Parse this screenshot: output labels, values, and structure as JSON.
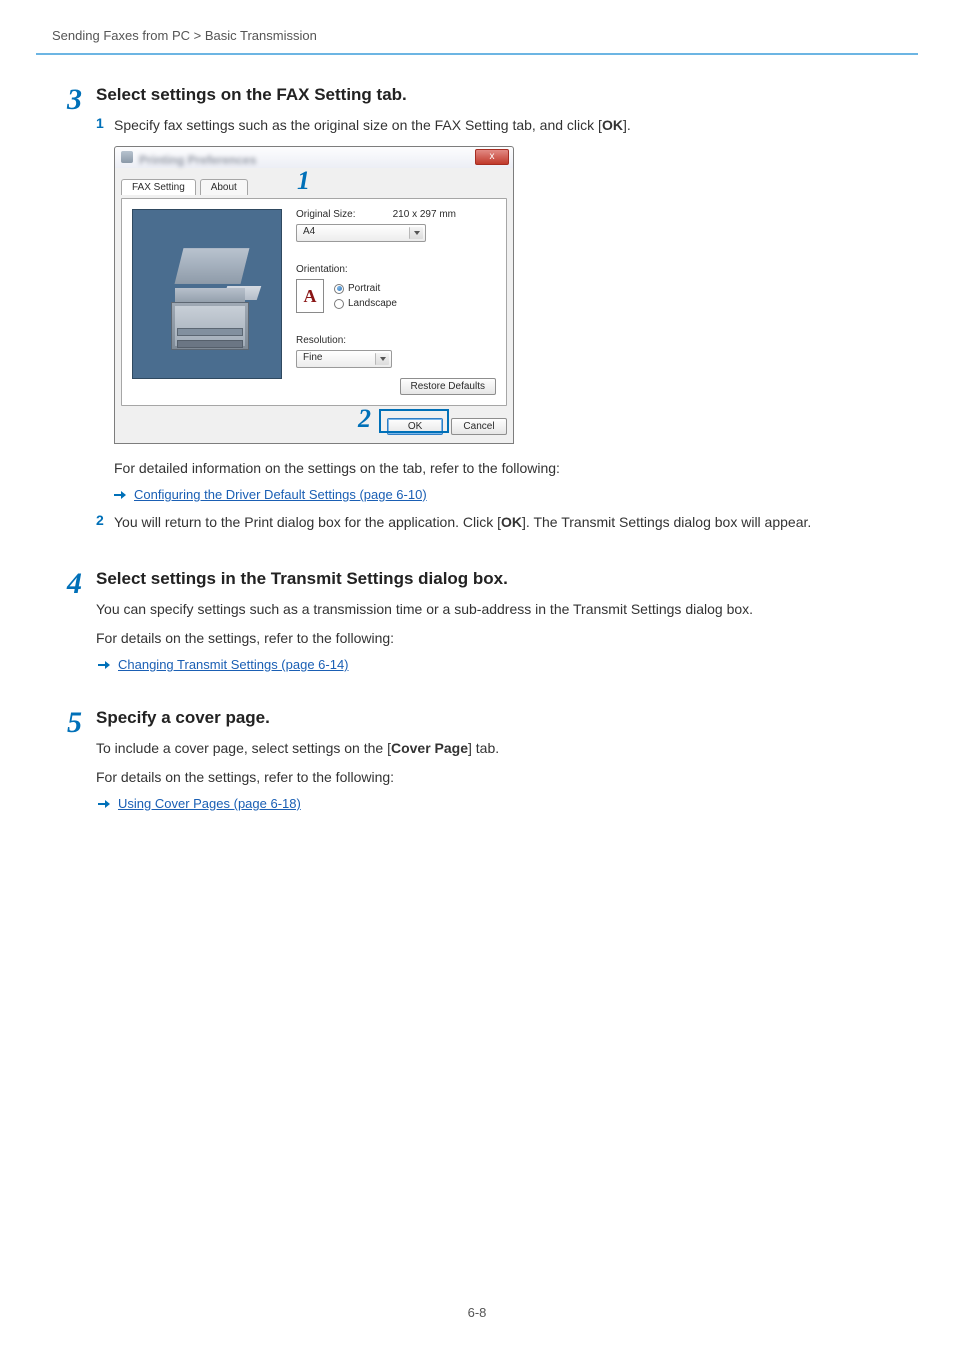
{
  "breadcrumb": "Sending Faxes from PC > Basic Transmission",
  "step3": {
    "num": "3",
    "title": "Select settings on the FAX Setting tab.",
    "sub1_num": "1",
    "sub1_text_pre": "Specify fax settings such as the original size on the FAX Setting tab, and click [",
    "sub1_text_bold": "OK",
    "sub1_text_post": "].",
    "after_img": "For detailed information on the settings on the tab, refer to the following:",
    "link": "Configuring the Driver Default Settings (page 6-10)",
    "sub2_num": "2",
    "sub2_text_pre": "You will return to the Print dialog box for the application. Click [",
    "sub2_text_bold": "OK",
    "sub2_text_post": "]. The Transmit Settings dialog box will appear."
  },
  "step4": {
    "num": "4",
    "title": "Select settings in the Transmit Settings dialog box.",
    "p1": "You can specify settings such as a transmission time or a sub-address in the Transmit Settings dialog box.",
    "p2": "For details on the settings, refer to the following:",
    "link": "Changing Transmit Settings (page 6-14)"
  },
  "step5": {
    "num": "5",
    "title": "Specify a cover page.",
    "p1_pre": "To include a cover page, select settings on the [",
    "p1_bold": "Cover Page",
    "p1_post": "] tab.",
    "p2": "For details on the settings, refer to the following:",
    "link": "Using Cover Pages (page 6-18)"
  },
  "dialog": {
    "title_blur": "Printing Preferences",
    "close": "x",
    "tab1": "FAX Setting",
    "tab2": "About",
    "callout1": "1",
    "orig_size_label": "Original Size:",
    "orig_size_dim": "210 x 297 mm",
    "orig_size_value": "A4",
    "orientation_label": "Orientation:",
    "orient_icon_letter": "A",
    "portrait": "Portrait",
    "landscape": "Landscape",
    "resolution_label": "Resolution:",
    "resolution_value": "Fine",
    "restore": "Restore Defaults",
    "callout2": "2",
    "ok": "OK",
    "cancel": "Cancel"
  },
  "page_number": "6-8"
}
